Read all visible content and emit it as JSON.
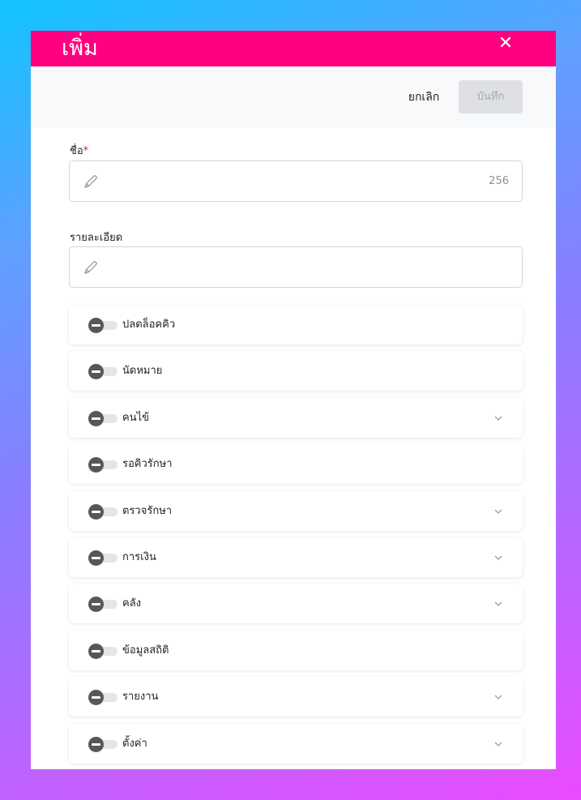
{
  "dialog": {
    "title": "เพิ่ม",
    "cancel_label": "ยกเลิก",
    "save_label": "บันทึก"
  },
  "form": {
    "name": {
      "label": "ชื่อ",
      "required_mark": "*",
      "counter": "256"
    },
    "description": {
      "label": "รายละเอียด"
    }
  },
  "permissions": [
    {
      "label": "ปลดล็อคคิว",
      "expandable": false,
      "enabled": false
    },
    {
      "label": "นัดหมาย",
      "expandable": false,
      "enabled": false
    },
    {
      "label": "คนไข้",
      "expandable": true,
      "enabled": false
    },
    {
      "label": "รอคิวรักษา",
      "expandable": false,
      "enabled": false
    },
    {
      "label": "ตรวจรักษา",
      "expandable": true,
      "enabled": false
    },
    {
      "label": "การเงิน",
      "expandable": true,
      "enabled": false
    },
    {
      "label": "คลัง",
      "expandable": true,
      "enabled": false
    },
    {
      "label": "ข้อมูลสถิติ",
      "expandable": false,
      "enabled": false
    },
    {
      "label": "รายงาน",
      "expandable": true,
      "enabled": false
    },
    {
      "label": "ตั้งค่า",
      "expandable": true,
      "enabled": false
    }
  ],
  "colors": {
    "accent": "#ff0080",
    "required": "#e0194a",
    "toggle_off_knob": "#575757"
  }
}
